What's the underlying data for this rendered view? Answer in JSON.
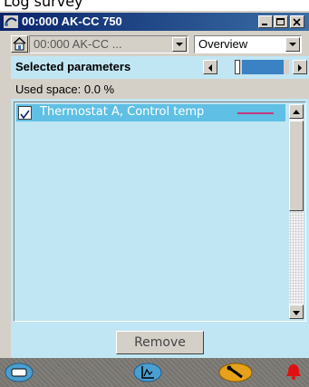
{
  "page": {
    "title": "Log survey"
  },
  "window": {
    "title": "00:000 AK-CC 750",
    "controls": {
      "minimize_icon": "minimize-icon",
      "maximize_icon": "maximize-icon",
      "close_icon": "close-icon"
    }
  },
  "toolbar": {
    "home_icon": "home-icon",
    "device_select_value": "00:000 AK-CC ...",
    "view_select_value": "Overview"
  },
  "header": {
    "label": "Selected parameters",
    "slider_level_percent": 88
  },
  "status": {
    "used_space": "Used space: 0.0 %"
  },
  "list": {
    "items": [
      {
        "label": "Thermostat A, Control temp",
        "checked": true,
        "selected": true
      }
    ]
  },
  "actions": {
    "remove_label": "Remove"
  },
  "footer": {
    "icons": [
      "device-icon",
      "graph-icon",
      "wrench-icon",
      "alarm-bell-icon"
    ]
  },
  "colors": {
    "accent_panel": "#c1e6f3",
    "selection": "#5fbfe4",
    "titlebar": "#0a246a"
  }
}
